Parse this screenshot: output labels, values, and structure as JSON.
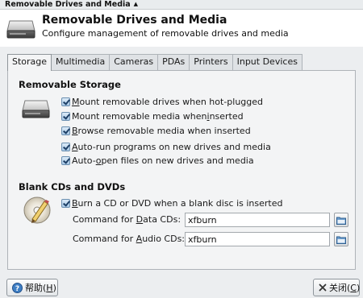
{
  "window": {
    "title": "Removable Drives and Media"
  },
  "header": {
    "title": "Removable Drives and Media",
    "subtitle": "Configure management of removable drives and media",
    "icon": "drive-icon"
  },
  "tabs": [
    {
      "label": "Storage",
      "active": true
    },
    {
      "label": "Multimedia"
    },
    {
      "label": "Cameras"
    },
    {
      "label": "PDAs"
    },
    {
      "label": "Printers"
    },
    {
      "label": "Input Devices"
    }
  ],
  "storage": {
    "section_title": "Removable Storage",
    "icon": "hard-drive-icon",
    "options": [
      {
        "mnemonic": "M",
        "rest": "ount removable drives when hot-plugged",
        "checked": true
      },
      {
        "pre": "Mount removable media when ",
        "mnemonic": "i",
        "rest": "nserted",
        "checked": true
      },
      {
        "mnemonic": "B",
        "rest": "rowse removable media when inserted",
        "checked": true
      },
      {
        "mnemonic": "A",
        "rest": "uto-run programs on new drives and media",
        "checked": true
      },
      {
        "pre": "Auto-",
        "mnemonic": "o",
        "rest": "pen files on new drives and media",
        "checked": true
      }
    ]
  },
  "blank_cds": {
    "section_title": "Blank CDs and DVDs",
    "icon": "cd-burn-icon",
    "burn_option": {
      "mnemonic": "B",
      "rest": "urn a CD or DVD when a blank disc is inserted",
      "checked": true
    },
    "data_cmd": {
      "pre": "Command for ",
      "mnemonic": "D",
      "rest": "ata CDs:",
      "value": "xfburn"
    },
    "audio_cmd": {
      "pre": "Command for ",
      "mnemonic": "A",
      "rest": "udio CDs:",
      "value": "xfburn"
    }
  },
  "buttons": {
    "help": {
      "label": "帮助(",
      "mnemonic": "H",
      "close_paren": ")"
    },
    "close": {
      "label": "关闭(",
      "mnemonic": "C",
      "close_paren": ")"
    }
  },
  "colors": {
    "accent": "#2f6fb6",
    "panel": "#f3f4f5",
    "window_bg": "#eceef0"
  }
}
